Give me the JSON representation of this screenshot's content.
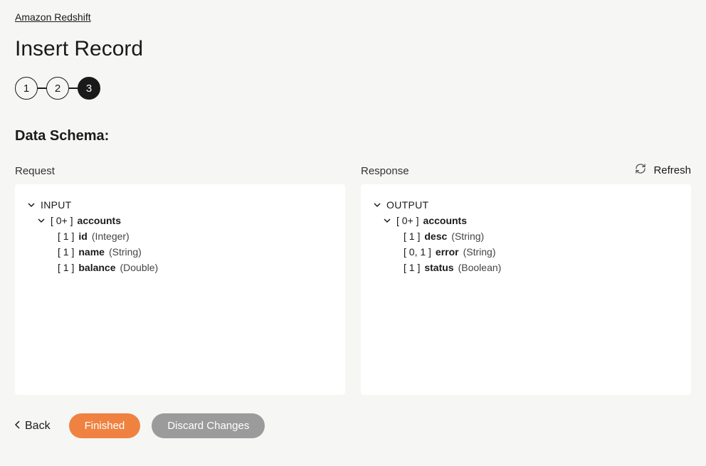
{
  "breadcrumb": "Amazon Redshift",
  "pageTitle": "Insert Record",
  "stepper": {
    "s1": "1",
    "s2": "2",
    "s3": "3"
  },
  "sectionHeading": "Data Schema:",
  "refresh": {
    "label": "Refresh"
  },
  "request": {
    "heading": "Request",
    "root": "INPUT",
    "group": {
      "card": "[ 0+ ]",
      "name": "accounts"
    },
    "fields": [
      {
        "card": "[ 1 ]",
        "name": "id",
        "type": "(Integer)"
      },
      {
        "card": "[ 1 ]",
        "name": "name",
        "type": "(String)"
      },
      {
        "card": "[ 1 ]",
        "name": "balance",
        "type": "(Double)"
      }
    ]
  },
  "response": {
    "heading": "Response",
    "root": "OUTPUT",
    "group": {
      "card": "[ 0+ ]",
      "name": "accounts"
    },
    "fields": [
      {
        "card": "[ 1 ]",
        "name": "desc",
        "type": "(String)"
      },
      {
        "card": "[ 0, 1 ]",
        "name": "error",
        "type": "(String)"
      },
      {
        "card": "[ 1 ]",
        "name": "status",
        "type": "(Boolean)"
      }
    ]
  },
  "footer": {
    "back": "Back",
    "finished": "Finished",
    "discard": "Discard Changes"
  }
}
